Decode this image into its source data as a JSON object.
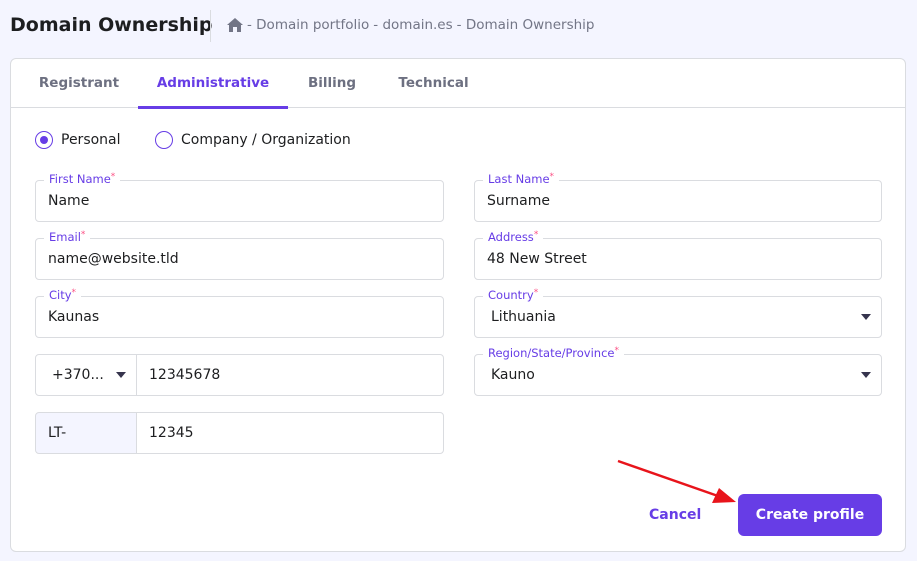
{
  "header": {
    "title": "Domain Ownership",
    "breadcrumb": [
      "- Domain portfolio",
      "- domain.es",
      "- Domain Ownership"
    ]
  },
  "tabs": [
    {
      "label": "Registrant"
    },
    {
      "label": "Administrative",
      "active": true
    },
    {
      "label": "Billing"
    },
    {
      "label": "Technical"
    }
  ],
  "contact_type": {
    "options": [
      "Personal",
      "Company / Organization"
    ],
    "selected": "Personal"
  },
  "form": {
    "first_name": {
      "label": "First Name",
      "value": "Name"
    },
    "last_name": {
      "label": "Last Name",
      "value": "Surname"
    },
    "email": {
      "label": "Email",
      "value": "name@website.tld"
    },
    "address": {
      "label": "Address",
      "value": "48 New Street"
    },
    "city": {
      "label": "City",
      "value": "Kaunas"
    },
    "country": {
      "label": "Country",
      "value": "Lithuania"
    },
    "phone_code": {
      "value": "+370..."
    },
    "phone": {
      "value": "12345678"
    },
    "region": {
      "label": "Region/State/Province",
      "value": "Kauno"
    },
    "zip_prefix": {
      "value": "LT-"
    },
    "zip": {
      "value": "12345"
    },
    "required_mark": "*"
  },
  "actions": {
    "cancel": "Cancel",
    "create": "Create profile"
  },
  "colors": {
    "accent": "#673de6",
    "arrow": "#e8141b"
  }
}
